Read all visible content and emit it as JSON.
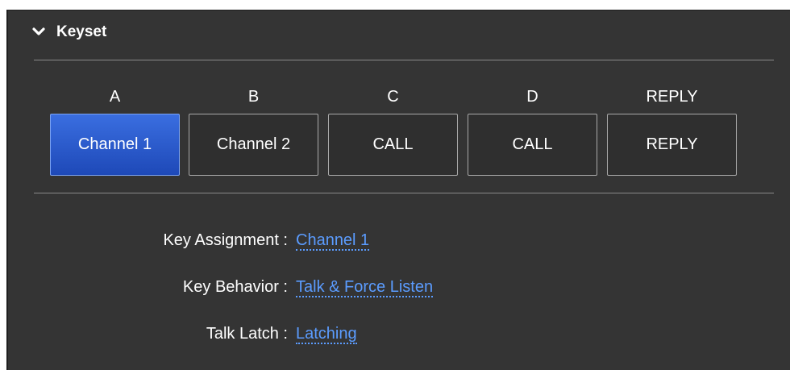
{
  "keyset": {
    "title": "Keyset",
    "keys": [
      {
        "letter": "A",
        "label": "Channel 1",
        "active": true
      },
      {
        "letter": "B",
        "label": "Channel 2",
        "active": false
      },
      {
        "letter": "C",
        "label": "CALL",
        "active": false
      },
      {
        "letter": "D",
        "label": "CALL",
        "active": false
      },
      {
        "letter": "REPLY",
        "label": "REPLY",
        "active": false
      }
    ]
  },
  "properties": {
    "key_assignment": {
      "label": "Key Assignment :",
      "value": "Channel 1"
    },
    "key_behavior": {
      "label": "Key Behavior :",
      "value": "Talk & Force Listen"
    },
    "talk_latch": {
      "label": "Talk Latch :",
      "value": "Latching"
    }
  },
  "colors": {
    "panel_bg": "#343434",
    "active_key": "#2456c9",
    "link_value": "#5b9cff"
  }
}
